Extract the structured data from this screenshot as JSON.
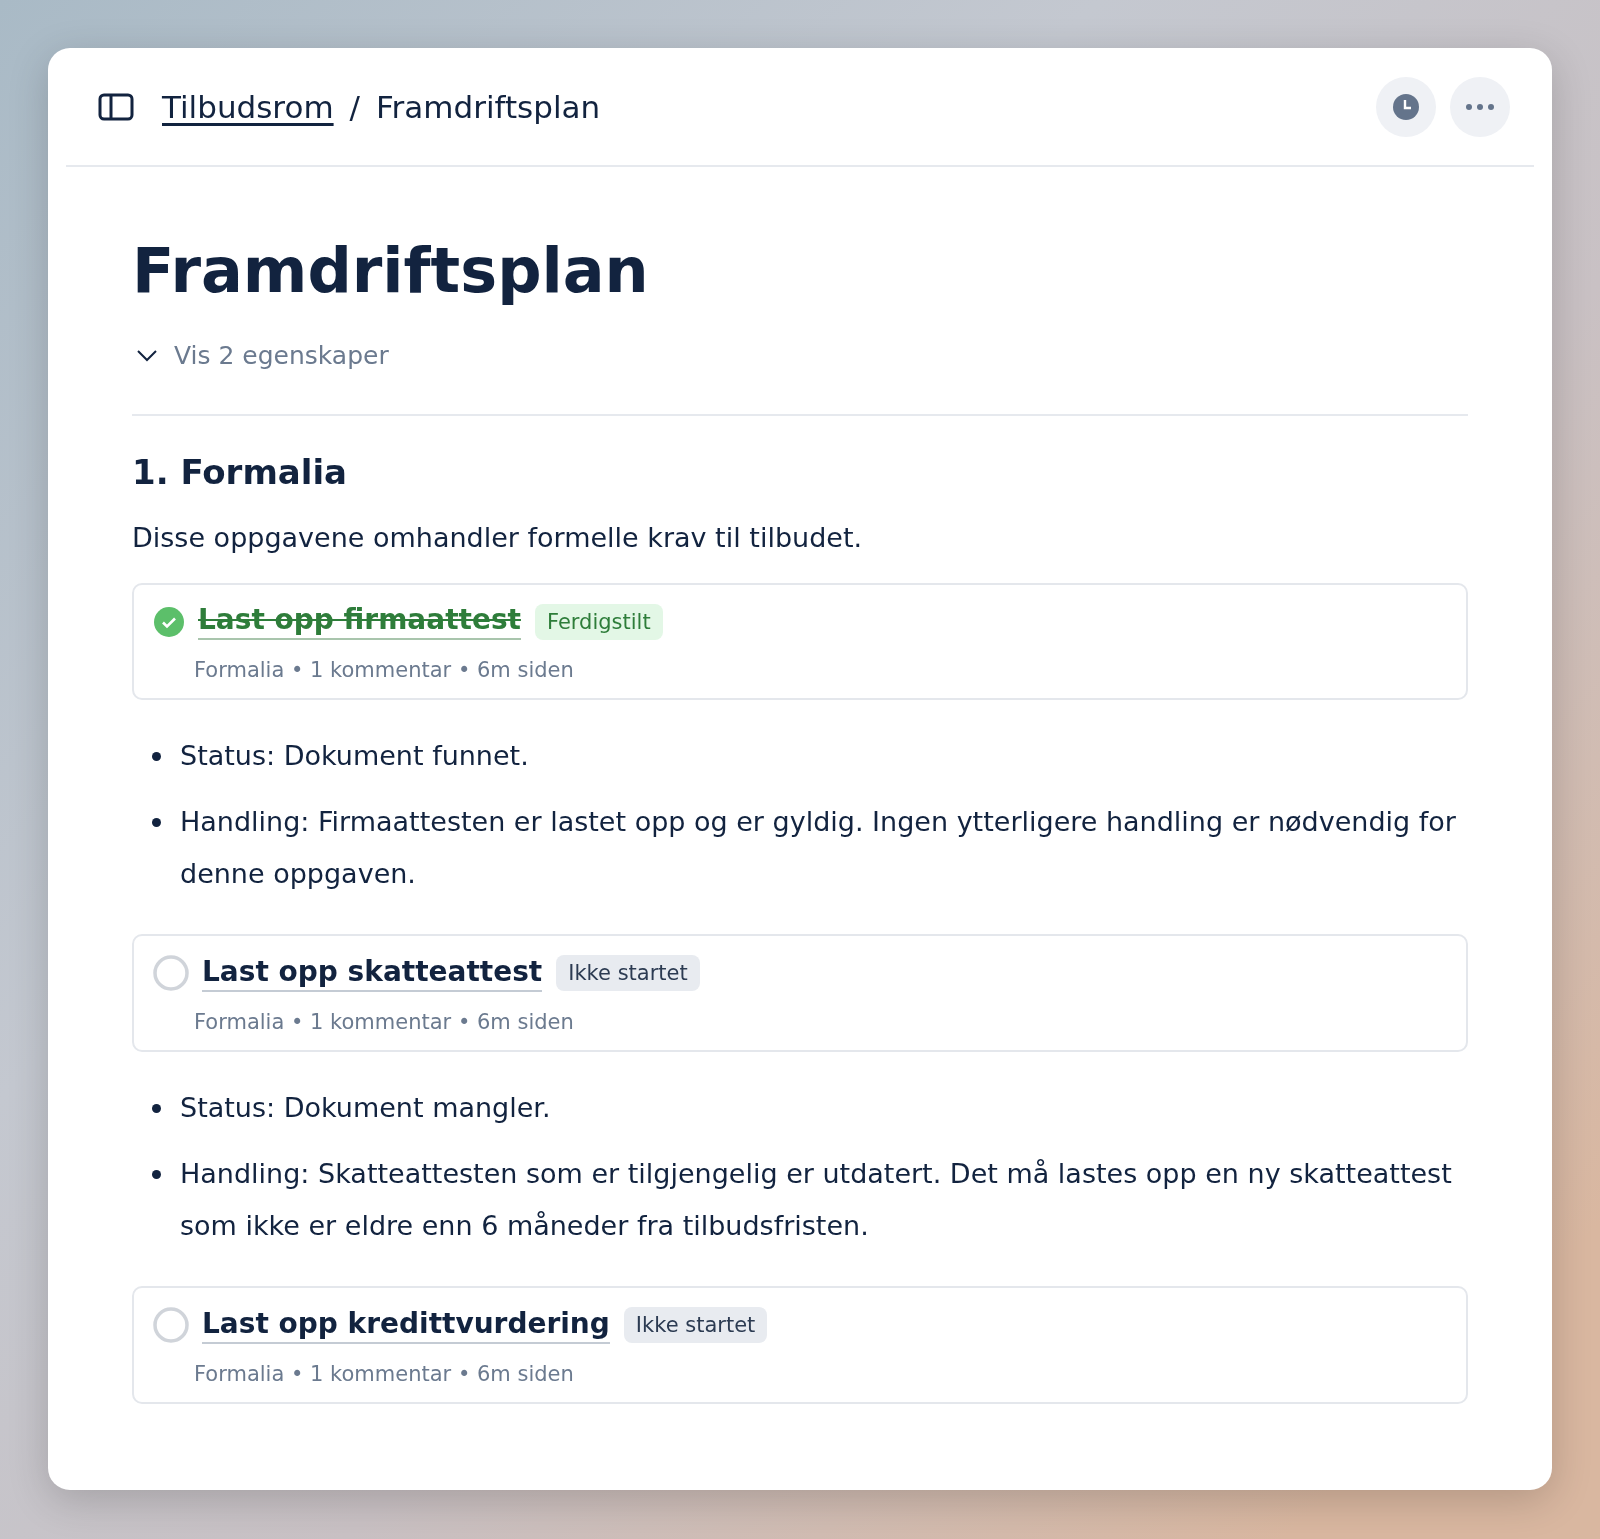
{
  "breadcrumb": {
    "parent": "Tilbudsrom",
    "separator": "/",
    "current": "Framdriftsplan"
  },
  "title": "Framdriftsplan",
  "properties_toggle": {
    "label": "Vis 2 egenskaper",
    "expanded": false
  },
  "section": {
    "heading": "1. Formalia",
    "description": "Disse oppgavene omhandler formelle krav til tilbudet.",
    "blocks": [
      {
        "kind": "task",
        "title": "Last opp firmaattest",
        "checked": true,
        "status": "Ferdigstilt",
        "meta": "Formalia • 1 kommentar • 6m siden"
      },
      {
        "kind": "bullets",
        "items": [
          "Status: Dokument funnet.",
          "Handling: Firmaattesten er lastet opp og er gyldig. Ingen ytterligere handling er nødvendig for denne oppgaven."
        ]
      },
      {
        "kind": "task",
        "title": "Last opp skatteattest",
        "checked": false,
        "status": "Ikke startet",
        "meta": "Formalia • 1 kommentar • 6m siden"
      },
      {
        "kind": "bullets",
        "items": [
          "Status: Dokument mangler.",
          "Handling: Skatteattesten som er tilgjengelig er utdatert. Det må lastes opp en ny skatteattest som ikke er eldre enn 6 måneder fra tilbudsfristen."
        ]
      },
      {
        "kind": "task",
        "title": "Last opp kredittvurdering",
        "checked": false,
        "status": "Ikke startet",
        "meta": "Formalia • 1 kommentar • 6m siden"
      }
    ]
  }
}
